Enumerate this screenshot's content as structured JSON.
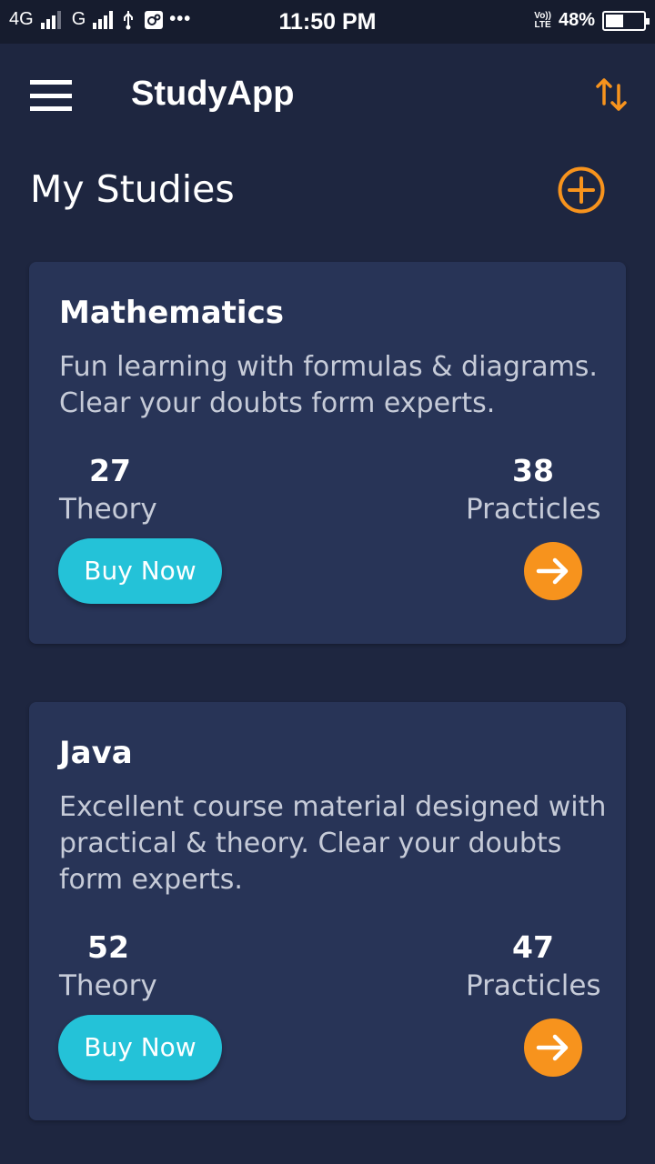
{
  "status_bar": {
    "network_1": "4G",
    "network_2": "G",
    "dots": "•••",
    "time": "11:50 PM",
    "volte_top": "Vo))",
    "volte_bottom": "LTE",
    "battery_percent": "48%",
    "battery_level": 0.48
  },
  "app_bar": {
    "title": "StudyApp"
  },
  "section": {
    "title": "My Studies"
  },
  "colors": {
    "background": "#1e2640",
    "card": "#283457",
    "accent_orange": "#f7931d",
    "accent_cyan": "#24c2d8"
  },
  "courses": [
    {
      "title": "Mathematics",
      "description": "Fun learning with formulas & diagrams. Clear your doubts form experts.",
      "theory_count": "27",
      "theory_label": "Theory",
      "practicles_count": "38",
      "practicles_label": "Practicles",
      "buy_label": "Buy Now"
    },
    {
      "title": "Java",
      "description": "Excellent course material designed with practical & theory. Clear your doubts form experts.",
      "theory_count": "52",
      "theory_label": "Theory",
      "practicles_count": "47",
      "practicles_label": "Practicles",
      "buy_label": "Buy Now"
    }
  ]
}
